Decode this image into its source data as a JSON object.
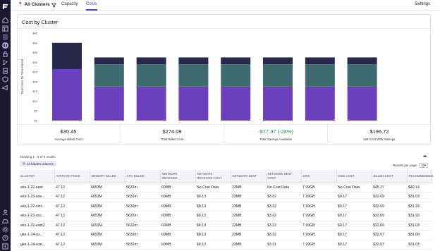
{
  "app": {
    "cluster_selector": "All Clusters",
    "tabs": [
      {
        "label": "Capacity",
        "active": false
      },
      {
        "label": "Costs",
        "active": true
      }
    ],
    "settings_label": "Settings"
  },
  "sidebar": {
    "top_icons": [
      "home-icon",
      "dashboard-icon",
      "list-icon",
      "cost-icon",
      "lock-icon",
      "branch-icon",
      "report-icon",
      "shield-icon",
      "megaphone-icon"
    ],
    "bottom_icons": [
      "user-icon",
      "car-icon",
      "settings-icon",
      "help-icon",
      "collapse-icon"
    ]
  },
  "chart": {
    "title": "Cost by Cluster",
    "ylabel": "Total Costs for Time Period",
    "yticks": [
      "$0",
      "$5",
      "$10",
      "$15",
      "$20",
      "$25",
      "$30",
      "$35",
      "$40",
      "$45"
    ],
    "colors": {
      "dark": "#28284a",
      "teal": "#3f6b70",
      "purple": "#6a40bd"
    }
  },
  "chart_data": {
    "type": "bar",
    "stacked": true,
    "categories": [
      "",
      "",
      "",
      "",
      "",
      "",
      "",
      ""
    ],
    "ylim": [
      0,
      45
    ],
    "series": [
      {
        "values": [
          26.5,
          17.5,
          17.5,
          17.5,
          17.5,
          17.5,
          17.5,
          17.5
        ]
      },
      {
        "values": [
          0,
          11.5,
          11.5,
          11.5,
          11.5,
          11.5,
          11.5,
          11.5
        ]
      },
      {
        "values": [
          13.5,
          3.5,
          3.5,
          3.5,
          3.5,
          3.5,
          3.5,
          3.5
        ]
      }
    ]
  },
  "stats": [
    {
      "value": "$30.45",
      "label": "Average Billed Cost",
      "green": false
    },
    {
      "value": "$274.09",
      "label": "Total Billed Cost",
      "green": false
    },
    {
      "value": "-$77.37 (-28%)",
      "label": "Total Savings Available",
      "green": true
    },
    {
      "value": "$196.72",
      "label": "Net Cost With Savings",
      "green": false
    }
  ],
  "table": {
    "showing": "Showing 1 - 9 of 9 results",
    "hidden_columns": "24 hidden columns",
    "rows_per_page_label": "Results per page",
    "rows_per_page": "10",
    "columns": [
      "CLUSTER",
      "AVERAGE PODS",
      "MEMORY BILLED",
      "CPU BILLED",
      "NETWORK RECEIVED",
      "NETWORK RECEIVED COST",
      "NETWORK SENT",
      "NETWORK SENT COST",
      "DISK",
      "DISK COST",
      "BILLED COST",
      "RECOMMENDED"
    ],
    "rows": [
      [
        "eks-1-22-east",
        "47.12",
        "6653M",
        "5632m",
        "60MB",
        "No Cost Data",
        "23MB",
        "No Cost Data",
        "7.99GB",
        "No Cost Data",
        "$45.27",
        "$40.14"
      ],
      [
        "eks-1-23-use...",
        "47.12",
        "6653M",
        "5632m",
        "60MB",
        "$8.13",
        "23MB",
        "$3.32",
        "7.99GB",
        "$0.17",
        "$32.69",
        "$31.03"
      ],
      [
        "eks-1-22-cen...",
        "47.12",
        "6653M",
        "5632m",
        "60MB",
        "$8.13",
        "23MB",
        "$3.32",
        "7.99GB",
        "$0.17",
        "$32.69",
        "$31.93"
      ],
      [
        "eks-1-23-usc...",
        "47.12",
        "6653M",
        "5632m",
        "60MB",
        "$8.13",
        "23MB",
        "$3.32",
        "7.99GB",
        "$0.17",
        "$32.69",
        "$31.93"
      ],
      [
        "eks-1-22-east2",
        "47.12",
        "6653M",
        "5632m",
        "60MB",
        "$8.13",
        "23MB",
        "$3.32",
        "7.99GB",
        "$0.17",
        "$32.69",
        "$31.03"
      ],
      [
        "gke-1-24-us...",
        "47.12",
        "6653M",
        "5632m",
        "60MB",
        "$8.13",
        "23MB",
        "$3.32",
        "7.99GB",
        "$0.17",
        "$32.67",
        "$31.08"
      ],
      [
        "gke-1-24-use...",
        "47.12",
        "6653M",
        "5632m",
        "60MB",
        "$8.13",
        "23MB",
        "$3.31",
        "7.99GB",
        "$0.17",
        "$32.67",
        "$31.03"
      ]
    ]
  }
}
